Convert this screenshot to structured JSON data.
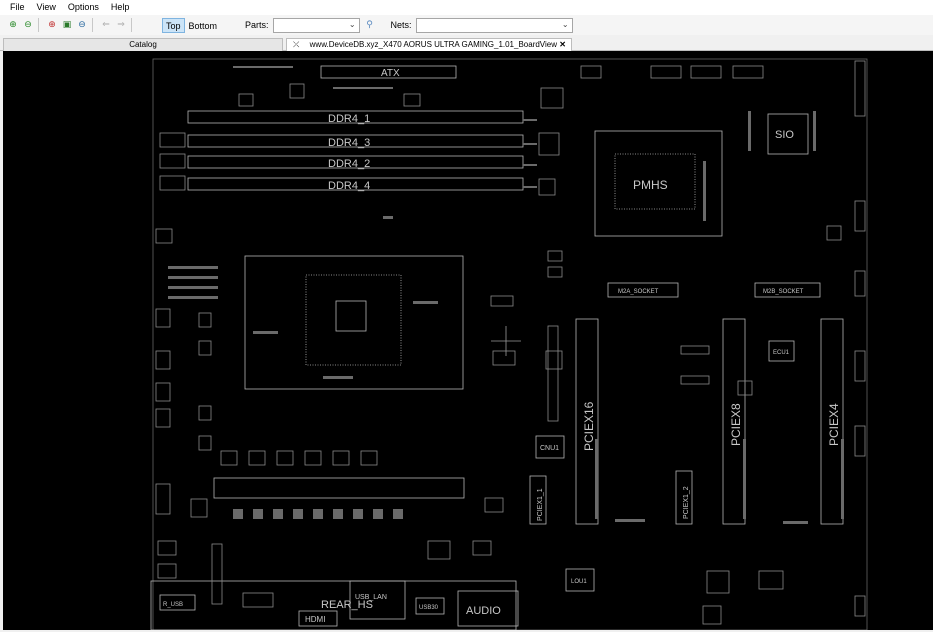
{
  "menu": {
    "items": [
      "File",
      "View",
      "Options",
      "Help"
    ]
  },
  "toolbar": {
    "top_label": "Top",
    "bottom_label": "Bottom",
    "parts_label": "Parts:",
    "parts_value": "",
    "nets_label": "Nets:",
    "nets_value": ""
  },
  "tabs": {
    "catalog": "Catalog",
    "board": "www.DeviceDB.xyz_X470 AORUS ULTRA GAMING_1.01_BoardView"
  },
  "board": {
    "labels": {
      "atx": "ATX",
      "ddr1": "DDR4_1",
      "ddr3": "DDR4_3",
      "ddr2": "DDR4_2",
      "ddr4": "DDR4_4",
      "pmhs": "PMHS",
      "sio": "SIO",
      "m2a": "M2A_SOCKET",
      "m2b": "M2B_SOCKET",
      "pciex16": "PCIEX16",
      "pciex8": "PCIEX8",
      "pciex4": "PCIEX4",
      "pciex1_1": "PCIEX1_1",
      "pciex1_2": "PCIEX1_2",
      "ecu1": "ECU1",
      "cnu1": "CNU1",
      "lou1": "LOU1",
      "rear_hs": "REAR_HS",
      "usb_lan": "USB_LAN",
      "audio": "AUDIO",
      "hdmi": "HDMI",
      "r_usb": "R_USB",
      "usb30": "USB30"
    },
    "colors": {
      "bg": "#000000",
      "outline": "#b4b4b4",
      "dim": "#8a8a8a",
      "text": "#c8c8c8"
    }
  }
}
